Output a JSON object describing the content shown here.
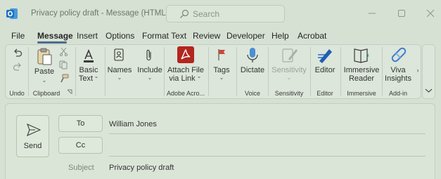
{
  "window": {
    "title": "Privacy policy draft  -  Message (HTML)",
    "search_placeholder": "Search"
  },
  "menu": {
    "items": [
      "File",
      "Message",
      "Insert",
      "Options",
      "Format Text",
      "Review",
      "Developer",
      "Help",
      "Acrobat"
    ],
    "active": "Message"
  },
  "ribbon": {
    "paste": "Paste",
    "basic_text_1": "Basic",
    "basic_text_2": "Text",
    "names": "Names",
    "include": "Include",
    "attach_1": "Attach File",
    "attach_2": "via Link",
    "tags": "Tags",
    "dictate": "Dictate",
    "sensitivity": "Sensitivity",
    "editor": "Editor",
    "immersive_1": "Immersive",
    "immersive_2": "Reader",
    "viva_1": "Viva",
    "viva_2": "Insights",
    "groups": {
      "undo": "Undo",
      "clipboard": "Clipboard",
      "adobe": "Adobe Acro...",
      "voice": "Voice",
      "sensitivity": "Sensitivity",
      "editor": "Editor",
      "immersive": "Immersive",
      "addin": "Add-in"
    }
  },
  "compose": {
    "send": "Send",
    "to_button": "To",
    "cc_button": "Cc",
    "to_value": "William Jones",
    "cc_value": "",
    "subject_label": "Subject",
    "subject_value": "Privacy policy draft"
  },
  "colors": {
    "background": "#d6e1d3",
    "outlook_blue": "#1a6fc4",
    "acrobat_red": "#b3261e",
    "accent_underline": "#4c6b8f"
  }
}
